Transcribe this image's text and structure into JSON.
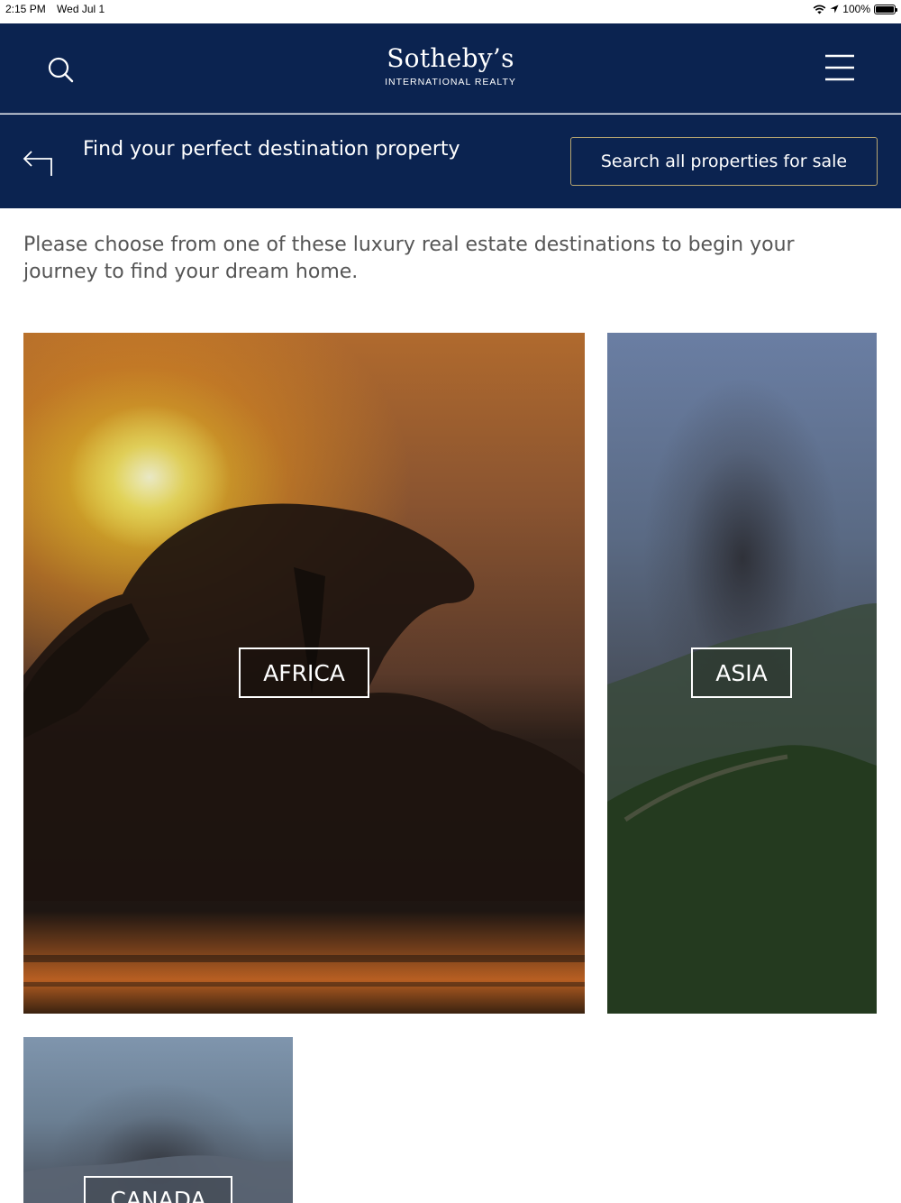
{
  "status_bar": {
    "time": "2:15 PM",
    "date": "Wed Jul 1",
    "battery_text": "100%",
    "battery_level": 1.0
  },
  "header": {
    "logo_main": "Sotheby’s",
    "logo_sub": "INTERNATIONAL REALTY",
    "search_icon": "search-icon",
    "menu_icon": "hamburger-menu-icon"
  },
  "subheader": {
    "title": "Find your perfect destination property",
    "back_icon": "back-arrow-icon",
    "search_all_label": "Search all properties for sale"
  },
  "intro_text": "Please choose from one of these luxury real estate destinations to begin your journey to find your dream home.",
  "destinations": [
    {
      "label": "AFRICA"
    },
    {
      "label": "ASIA"
    },
    {
      "label": "CANADA"
    }
  ],
  "colors": {
    "navy": "#0b2350",
    "gold_border": "#b6a570",
    "intro_text": "#555555"
  }
}
